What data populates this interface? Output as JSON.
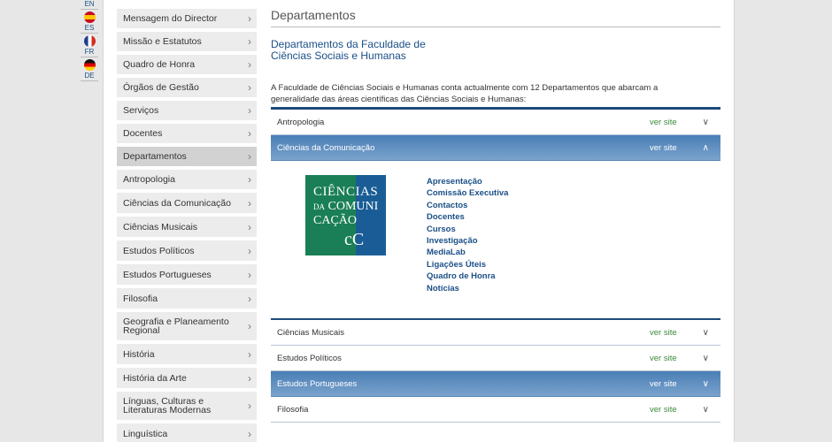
{
  "languages": [
    {
      "code": "EN"
    },
    {
      "code": "ES"
    },
    {
      "code": "FR"
    },
    {
      "code": "DE"
    }
  ],
  "nav": {
    "items": [
      {
        "label": "Mensagem do Director"
      },
      {
        "label": "Missão e Estatutos"
      },
      {
        "label": "Quadro de Honra"
      },
      {
        "label": "Órgãos de Gestão"
      },
      {
        "label": "Serviços"
      },
      {
        "label": "Docentes"
      },
      {
        "label": "Departamentos",
        "active": true
      },
      {
        "label": "Antropologia"
      },
      {
        "label": "Ciências da Comunicação"
      },
      {
        "label": "Ciências Musicais"
      },
      {
        "label": "Estudos Políticos"
      },
      {
        "label": "Estudos Portugueses"
      },
      {
        "label": "Filosofia"
      },
      {
        "label": "Geografia e Planeamento Regional"
      },
      {
        "label": "História"
      },
      {
        "label": "História da Arte"
      },
      {
        "label": "Línguas, Culturas e Literaturas Modernas"
      },
      {
        "label": "Linguística"
      }
    ]
  },
  "main": {
    "title": "Departamentos",
    "subtitle_line1": "Departamentos da Faculdade de",
    "subtitle_line2": "Ciências Sociais e Humanas",
    "intro_line1": "A Faculdade de Ciências Sociais e Humanas conta actualmente com 12 Departamentos que abarcam a",
    "intro_line2": "generalidade das áreas científicas das Ciências Sociais e Humanas:",
    "ver_site": "ver site",
    "accordion": [
      {
        "name": "Antropologia",
        "open": false
      },
      {
        "name": "Ciências da Comunicação",
        "open": true
      },
      {
        "name": "Ciências Musicais",
        "open": false
      },
      {
        "name": "Estudos Políticos",
        "open": false
      },
      {
        "name": "Estudos Portugueses",
        "open": true
      },
      {
        "name": "Filosofia",
        "open": false
      }
    ],
    "logo": {
      "line1": "CIÊNCIAS",
      "line2_small": "DA",
      "line2": "COMUNI",
      "line3": "CAÇÃO",
      "mark": "cC"
    },
    "links": [
      "Apresentação",
      "Comissão Executiva",
      "Contactos",
      "Docentes",
      "Cursos",
      "Investigação",
      "MediaLab",
      "Ligações Úteis",
      "Quadro de Honra",
      "Notícias"
    ]
  }
}
